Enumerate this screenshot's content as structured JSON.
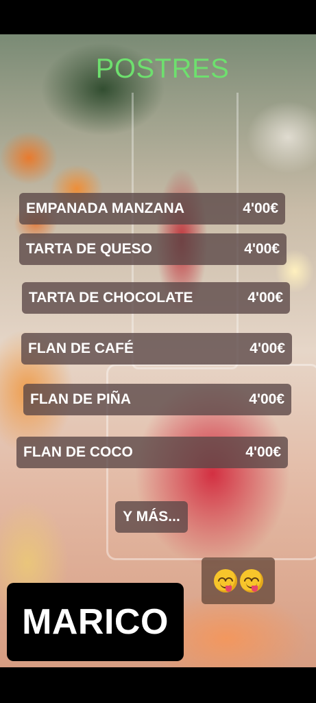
{
  "menu": {
    "title": "POSTRES",
    "items": [
      {
        "name": "EMPANADA MANZANA",
        "price": "4'00€"
      },
      {
        "name": "TARTA DE QUESO",
        "price": "4'00€"
      },
      {
        "name": "TARTA DE CHOCOLATE",
        "price": "4'00€"
      },
      {
        "name": "FLAN DE CAFÉ",
        "price": "4'00€"
      },
      {
        "name": "FLAN DE PIÑA",
        "price": "4'00€"
      },
      {
        "name": "FLAN DE COCO",
        "price": "4'00€"
      }
    ],
    "more_label": "Y MÁS..."
  },
  "emojis": [
    "face-savoring-food-icon",
    "face-savoring-food-icon"
  ],
  "brand": {
    "name": "MARICO"
  },
  "colors": {
    "title": "#6ee06e",
    "item_background": "rgba(90,70,70,0.78)",
    "brand_background": "#000000"
  }
}
